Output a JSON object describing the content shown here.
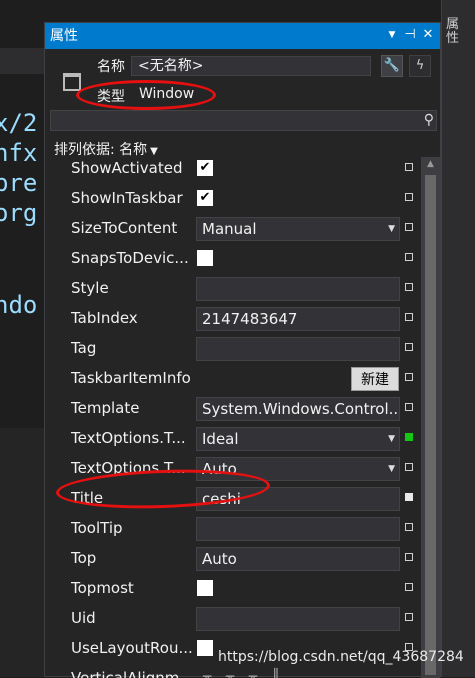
{
  "editor": {
    "code_lines": [
      "x/2",
      "nfx",
      "pre",
      "org",
      "ndo"
    ]
  },
  "right_tab": {
    "label": "属性"
  },
  "panel": {
    "title": "属性",
    "titlebar_buttons": {
      "dropdown": "▼",
      "pin": "⊣",
      "close": "✕"
    },
    "name_label": "名称",
    "name_value": "<无名称>",
    "type_label": "类型",
    "type_value": "Window",
    "sort_label": "排列依据: 名称",
    "sort_caret": "▼",
    "search_icon": "⚲",
    "wrench_icon": "🔧",
    "events_icon": "ϟ"
  },
  "properties": [
    {
      "name": "ShowActivated",
      "kind": "checkbox",
      "checked": true,
      "marker": "empty"
    },
    {
      "name": "ShowInTaskbar",
      "kind": "checkbox",
      "checked": true,
      "marker": "empty"
    },
    {
      "name": "SizeToContent",
      "kind": "dropdown",
      "value": "Manual",
      "marker": "empty"
    },
    {
      "name": "SnapsToDevic...",
      "kind": "checkbox",
      "checked": false,
      "marker": "empty"
    },
    {
      "name": "Style",
      "kind": "text",
      "value": "",
      "marker": "empty"
    },
    {
      "name": "TabIndex",
      "kind": "text",
      "value": "2147483647",
      "marker": "empty"
    },
    {
      "name": "Tag",
      "kind": "text",
      "value": "",
      "marker": "empty"
    },
    {
      "name": "TaskbarItemInfo",
      "kind": "button",
      "value": "新建",
      "marker": "empty"
    },
    {
      "name": "Template",
      "kind": "text",
      "value": "System.Windows.Control...",
      "marker": "empty"
    },
    {
      "name": "TextOptions.T...",
      "kind": "dropdown",
      "value": "Ideal",
      "marker": "green"
    },
    {
      "name": "TextOptions.T...",
      "kind": "dropdown",
      "value": "Auto",
      "marker": "empty"
    },
    {
      "name": "Title",
      "kind": "text",
      "value": "ceshi",
      "marker": "filled"
    },
    {
      "name": "ToolTip",
      "kind": "text",
      "value": "",
      "marker": "empty"
    },
    {
      "name": "Top",
      "kind": "text",
      "value": "Auto",
      "marker": "empty"
    },
    {
      "name": "Topmost",
      "kind": "checkbox",
      "checked": false,
      "marker": "empty"
    },
    {
      "name": "Uid",
      "kind": "text",
      "value": "",
      "marker": "empty"
    },
    {
      "name": "UseLayoutRou...",
      "kind": "checkbox",
      "checked": false,
      "marker": "empty"
    },
    {
      "name": "VerticalAlignm...",
      "kind": "tools",
      "value": "",
      "marker": "none"
    }
  ],
  "watermark": "https://blog.csdn.net/qq_43687284",
  "colors": {
    "accent": "#007acc",
    "annotation": "#e51010",
    "panel_bg": "#252526"
  }
}
